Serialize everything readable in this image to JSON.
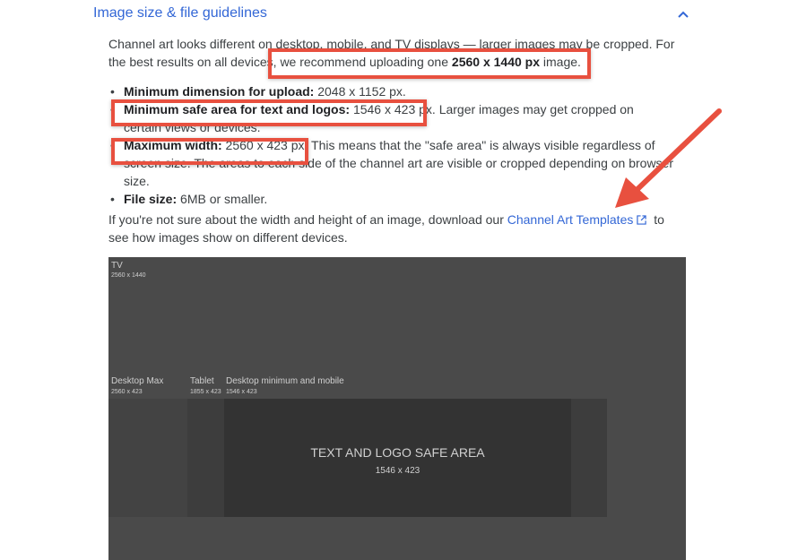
{
  "section": {
    "title": "Image size & file guidelines"
  },
  "intro": {
    "line1": "Channel art looks different on desktop, mobile, and TV displays — larger images may be cropped. For",
    "line2_prefix": "the best results on all devices, ",
    "line2_mid": "we recommend uploading one ",
    "line2_bold": "2560 x 1440 px",
    "line2_suffix": " image."
  },
  "bullets": [
    {
      "label": "Minimum dimension for upload:",
      "text": " 2048 x 1152 px."
    },
    {
      "label": "Minimum safe area for text and logos:",
      "text": " 1546 x 423 px.",
      "extra": " Larger images may get cropped on certain views or devices."
    },
    {
      "label": "Maximum width:",
      "text": " 2560 x 423 px.",
      "extra": " This means that the \"safe area\" is always visible regardless of screen size. The areas to each side of the channel art are visible or cropped depending on browser size."
    },
    {
      "label": "File size:",
      "text": " 6MB or smaller."
    }
  ],
  "templates_para": {
    "before": "If you're not sure about the width and height of an image, download our ",
    "link": "Channel Art Templates",
    "after": " to see how images show on different devices."
  },
  "diagram": {
    "tv_label": "TV",
    "tv_size": "2560 x 1440",
    "desktop_max_label": "Desktop Max",
    "desktop_max_size": "2560 x 423",
    "tablet_label": "Tablet",
    "tablet_size": "1855 x 423",
    "desktop_min_label": "Desktop minimum and mobile",
    "desktop_min_size": "1546 x 423",
    "safe_title": "TEXT AND LOGO SAFE AREA",
    "safe_size": "1546 x 423"
  },
  "colors": {
    "link": "#3367d6",
    "annotation": "#e8503f",
    "diagram_bg": "#4a4a4a",
    "safe_area": "#333333"
  }
}
